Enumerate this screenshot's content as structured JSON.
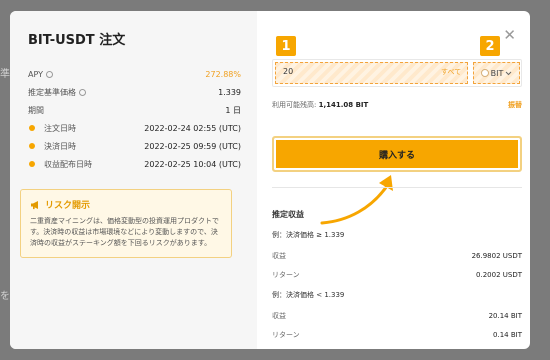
{
  "background": {
    "text_1": "準信",
    "text_2": "を"
  },
  "modal": {
    "title": "BIT-USDT 注文",
    "rows": [
      {
        "label": "APY",
        "value": "272.88%"
      },
      {
        "label": "推定基準価格",
        "value": "1.339"
      },
      {
        "label": "期間",
        "value": "1 日"
      },
      {
        "label": "注文日時",
        "value": "2022-02-24 02:55 (UTC)"
      },
      {
        "label": "決済日時",
        "value": "2022-02-25 09:59 (UTC)"
      },
      {
        "label": "収益配布日時",
        "value": "2022-02-25 10:04 (UTC)"
      }
    ],
    "risk": {
      "title": "リスク開示",
      "body": "二重資産マイニングは、価格変動型の投資運用プロダクトです。決済時の収益は市場環境などにより変動しますので、決済時の収益がステーキング額を下回るリスクがあります。"
    },
    "right": {
      "badge_1": "1",
      "badge_2": "2",
      "input_value": "20",
      "input_all": "すべて",
      "coin": "BIT",
      "available_label": "利用可能残高:",
      "available_value": "1,141.08 BIT",
      "transfer_link": "振替",
      "buy_button": "購入する",
      "estimate_title": "推定収益",
      "examples": [
        {
          "heading": "例：決済価格 ≥ 1.339",
          "rows": [
            {
              "label": "収益",
              "value": "26.9802 USDT"
            },
            {
              "label": "リターン",
              "value": "0.2002 USDT"
            }
          ]
        },
        {
          "heading": "例：決済価格 < 1.339",
          "rows": [
            {
              "label": "収益",
              "value": "20.14 BIT"
            },
            {
              "label": "リターン",
              "value": "0.14 BIT"
            }
          ]
        }
      ]
    }
  },
  "colors": {
    "accent": "#f7a600",
    "backdrop": "#7b7b7b"
  }
}
